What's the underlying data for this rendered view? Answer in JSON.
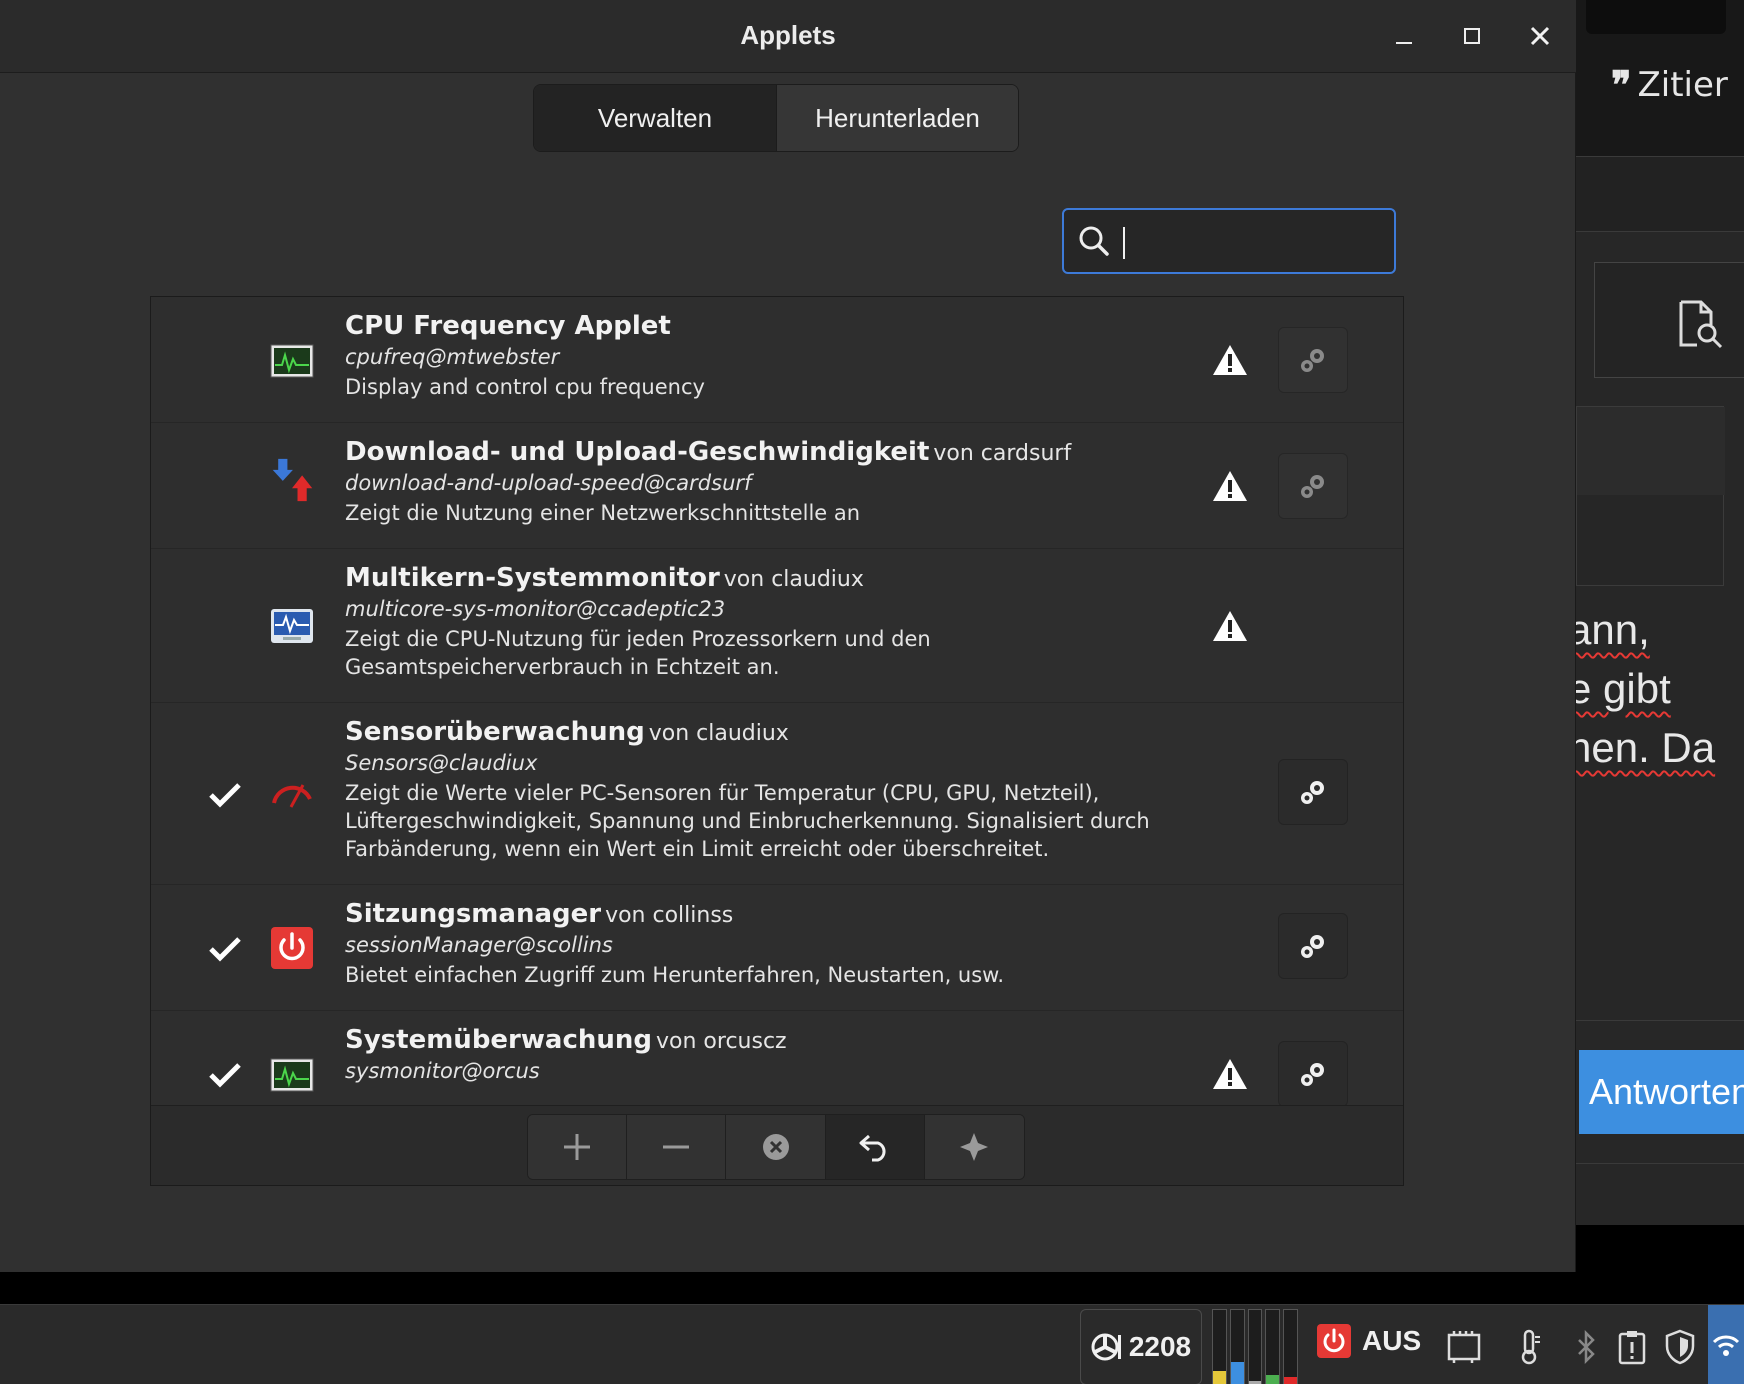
{
  "window": {
    "title": "Applets"
  },
  "tabs": [
    {
      "label": "Verwalten",
      "active": true
    },
    {
      "label": "Herunterladen",
      "active": false
    }
  ],
  "search": {
    "value": "",
    "placeholder": ""
  },
  "applets": [
    {
      "name": "CPU Frequency Applet",
      "author": "",
      "uuid": "cpufreq@mtwebster",
      "description": "Display and control cpu frequency",
      "enabled": false,
      "warning": true,
      "configurable": true,
      "icon": "cpu-graph-icon"
    },
    {
      "name": "Download- und Upload-Geschwindigkeit",
      "author": "von cardsurf",
      "uuid": "download-and-upload-speed@cardsurf",
      "description": "Zeigt die Nutzung einer Netzwerkschnittstelle an",
      "enabled": false,
      "warning": true,
      "configurable": true,
      "icon": "up-down-arrows-icon"
    },
    {
      "name": "Multikern-Systemmonitor",
      "author": "von claudiux",
      "uuid": "multicore-sys-monitor@ccadeptic23",
      "description": "Zeigt die CPU-Nutzung für jeden Prozessorkern und den Gesamtspeicherverbrauch in Echtzeit an.",
      "enabled": false,
      "warning": true,
      "configurable": false,
      "icon": "system-monitor-icon"
    },
    {
      "name": "Sensorüberwachung",
      "author": "von claudiux",
      "uuid": "Sensors@claudiux",
      "description": "Zeigt die Werte vieler PC-Sensoren für Temperatur (CPU, GPU, Netzteil), Lüftergeschwindigkeit, Spannung und Einbrucherkennung. Signalisiert durch Farbänderung, wenn ein Wert ein Limit erreicht oder überschreitet.",
      "enabled": true,
      "warning": false,
      "configurable": true,
      "icon": "gauge-icon"
    },
    {
      "name": "Sitzungsmanager",
      "author": "von collinss",
      "uuid": "sessionManager@scollins",
      "description": "Bietet einfachen Zugriff zum Herunterfahren, Neustarten, usw.",
      "enabled": true,
      "warning": false,
      "configurable": true,
      "icon": "power-icon"
    },
    {
      "name": "Systemüberwachung",
      "author": "von orcuscz",
      "uuid": "sysmonitor@orcus",
      "description": "",
      "enabled": true,
      "warning": true,
      "configurable": true,
      "icon": "cpu-graph-icon"
    }
  ],
  "toolbar": {
    "buttons": [
      "add-icon",
      "remove-icon",
      "uninstall-icon",
      "undo-icon",
      "more-icon"
    ]
  },
  "background": {
    "quote_label": "Zitier",
    "text_lines": [
      "ann,",
      "e gibt",
      "hen. Da"
    ],
    "reply_label": "Antworten"
  },
  "panel": {
    "cpu_freq": "2208",
    "session_label": "AUS"
  },
  "colors": {
    "accent": "#3d7ad8",
    "reply_button": "#3d8fe0",
    "power_red": "#e53935"
  }
}
